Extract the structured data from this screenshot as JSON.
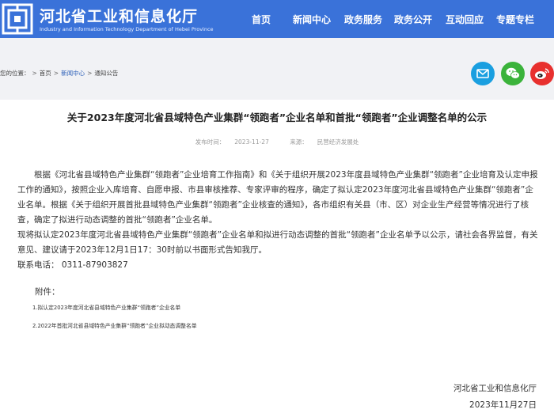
{
  "header": {
    "title": "河北省工业和信息化厅",
    "subtitle": "Industry and Information Technology Department of Hebei Province",
    "nav": [
      "首页",
      "新闻中心",
      "政务服务",
      "政务公开",
      "互动回应",
      "专题专栏"
    ],
    "bg_color": "#3a72d9"
  },
  "breadcrumb": {
    "prefix": "您的位置：",
    "items": [
      "首页",
      "新闻中心",
      "通知公告"
    ],
    "separator": ">"
  },
  "share": {
    "icons": [
      "email-icon",
      "wechat-icon",
      "weibo-icon"
    ],
    "colors": [
      "#1a9fe0",
      "#3bb33b",
      "#e8302e"
    ]
  },
  "article": {
    "title": "关于2023年度河北省县域特色产业集群“领跑者”企业名单和首批“领跑者”企业调整名单的公示",
    "date_label": "发布时间：",
    "date": "2023-11-27",
    "source_label": "来源：",
    "source": "民营经济发展处",
    "paragraph1": "根据《河北省县域特色产业集群“领跑者”企业培育工作指南》和《关于组织开展2023年度县域特色产业集群“领跑者”企业培育及认定申报工作的通知》，按照企业入库培育、自愿申报、市县审核推荐、专家评审的程序，确定了拟认定2023年度河北省县域特色产业集群“领跑者”企业名单。根据《关于组织开展首批县域特色产业集群“领跑者”企业核查的通知》，各市组织有关县（市、区）对企业生产经营等情况进行了核查，确定了拟进行动态调整的首批“领跑者”企业名单。",
    "paragraph2": "现将拟认定2023年度河北省县域特色产业集群“领跑者”企业名单和拟进行动态调整的首批“领跑者”企业名单予以公示，请社会各界监督，有关意见、建议请于2023年12月1日17：30时前以书面形式告知我厅。",
    "contact": "联系电话：  0311-87903827",
    "attachments_label": "附件：",
    "attachments": [
      "1.拟认定2023年度河北省县域特色产业集群“领跑者”企业名单",
      "2.2022年首批河北省县域特色产业集群“领跑者”企业拟动态调整名单"
    ],
    "signature_org": "河北省工业和信息化厅",
    "signature_date": "2023年11月27日"
  }
}
